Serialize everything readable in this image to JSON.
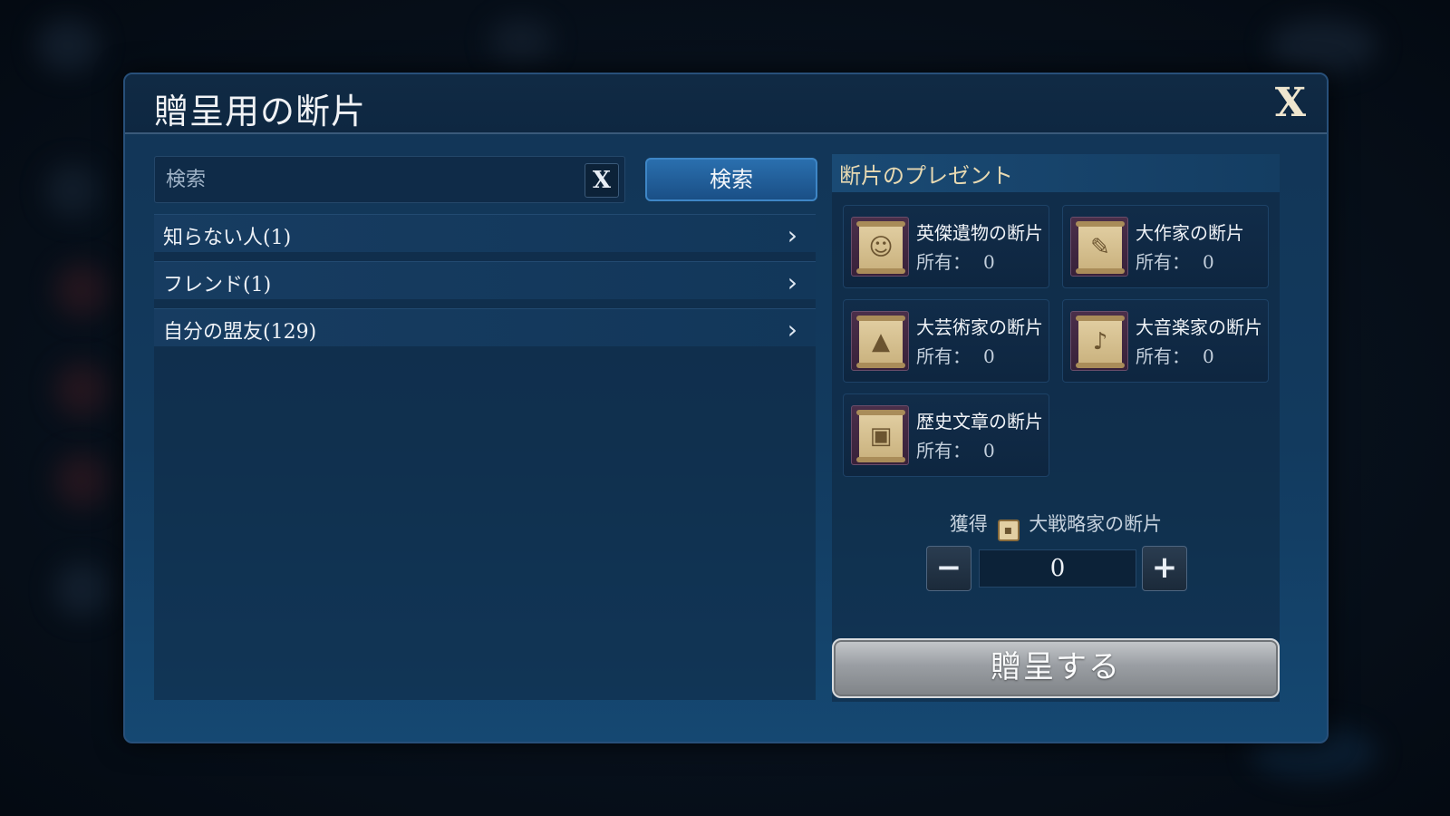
{
  "dialog": {
    "title": "贈呈用の断片",
    "close_label": "X"
  },
  "search": {
    "placeholder": "検索",
    "clear_label": "X",
    "button_label": "検索"
  },
  "recipient_list": [
    {
      "label": "知らない人(1)"
    },
    {
      "label": "フレンド(1)"
    },
    {
      "label": "自分の盟友(129)"
    }
  ],
  "chevron": "›",
  "fragments_panel": {
    "title": "断片のプレゼント",
    "items": [
      {
        "name": "英傑遺物の断片",
        "owned_label": "所有：",
        "owned": "0",
        "icon": "bust-scroll-icon"
      },
      {
        "name": "大作家の断片",
        "owned_label": "所有：",
        "owned": "0",
        "icon": "quill-scroll-icon"
      },
      {
        "name": "大芸術家の断片",
        "owned_label": "所有：",
        "owned": "0",
        "icon": "painting-scroll-icon"
      },
      {
        "name": "大音楽家の断片",
        "owned_label": "所有：",
        "owned": "0",
        "icon": "music-scroll-icon"
      },
      {
        "name": "歴史文章の断片",
        "owned_label": "所有：",
        "owned": "0",
        "icon": "chest-scroll-icon"
      }
    ]
  },
  "obtain": {
    "prefix": "獲得",
    "item_name": "大戦略家の断片",
    "quantity": "0",
    "minus_label": "−",
    "plus_label": "+"
  },
  "gift_button_label": "贈呈する"
}
